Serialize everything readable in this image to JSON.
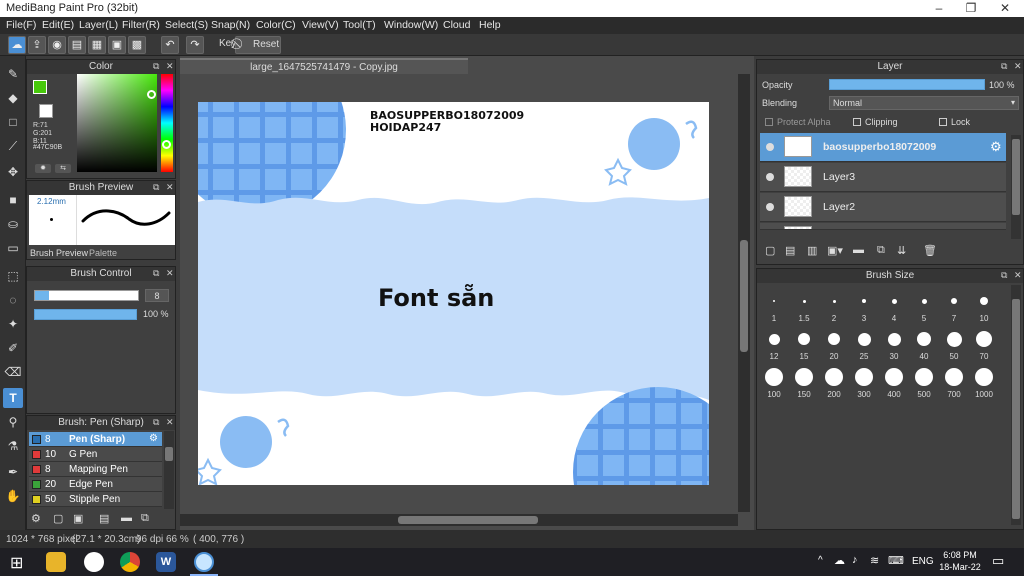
{
  "window": {
    "title": "MediBang Paint Pro (32bit)",
    "controls": [
      "–",
      "❐",
      "✕"
    ]
  },
  "menu": [
    "File(F)",
    "Edit(E)",
    "Layer(L)",
    "Filter(R)",
    "Select(S)",
    "Snap(N)",
    "Color(C)",
    "View(V)",
    "Tool(T)",
    "Window(W)",
    "Cloud",
    "Help"
  ],
  "toolbar": {
    "key_label": "Key",
    "reset_label": "Reset"
  },
  "color_panel": {
    "title": "Color",
    "rgb": [
      "R:71",
      "G:201",
      "B:11"
    ],
    "hex": "#47C90B",
    "primary_color": "#47C90B"
  },
  "brush_preview": {
    "title": "Brush Preview",
    "size": "2.12mm",
    "tabs": [
      "Brush Preview",
      "Palette"
    ]
  },
  "brush_control": {
    "title": "Brush Control",
    "size_value": "8",
    "opacity_value": "100 %"
  },
  "brush_list": {
    "title": "Brush: Pen (Sharp)",
    "items": [
      {
        "size": "8",
        "name": "Pen (Sharp)",
        "color": "#2a6fb0",
        "selected": true
      },
      {
        "size": "10",
        "name": "G Pen",
        "color": "#e03a3a"
      },
      {
        "size": "8",
        "name": "Mapping Pen",
        "color": "#e03a3a"
      },
      {
        "size": "20",
        "name": "Edge Pen",
        "color": "#3aa23a"
      },
      {
        "size": "50",
        "name": "Stipple Pen",
        "color": "#e0d020"
      }
    ]
  },
  "document": {
    "tab_title": "large_1647525741479 - Copy.jpg",
    "text_line1": "BAOSUPPERBO18072009",
    "text_line2": "HOIDAP247",
    "main_text": "Font sẵn"
  },
  "layer_panel": {
    "title": "Layer",
    "opacity_label": "Opacity",
    "opacity_value": "100 %",
    "blending_label": "Blending",
    "blending_value": "Normal",
    "protect_alpha": "Protect Alpha",
    "clipping": "Clipping",
    "lock": "Lock",
    "layers": [
      {
        "name": "baosupperbo18072009",
        "selected": true
      },
      {
        "name": "Layer3",
        "selected": false
      },
      {
        "name": "Layer2",
        "selected": false
      },
      {
        "name": "Layer1",
        "selected": false
      }
    ]
  },
  "brush_size": {
    "title": "Brush Size",
    "sizes": [
      "1",
      "1.5",
      "2",
      "3",
      "4",
      "5",
      "7",
      "10",
      "12",
      "15",
      "20",
      "25",
      "30",
      "40",
      "50",
      "70",
      "100",
      "150",
      "200",
      "300",
      "400",
      "500",
      "700",
      "1000"
    ]
  },
  "status": {
    "dimensions": "1024 * 768 pixel",
    "physical": "(27.1 * 20.3cm)",
    "dpi": "96 dpi",
    "zoom": "66 %",
    "coords": "( 400, 776 )"
  },
  "taskbar": {
    "lang": "ENG",
    "time": "6:08 PM",
    "date": "18-Mar-22"
  }
}
